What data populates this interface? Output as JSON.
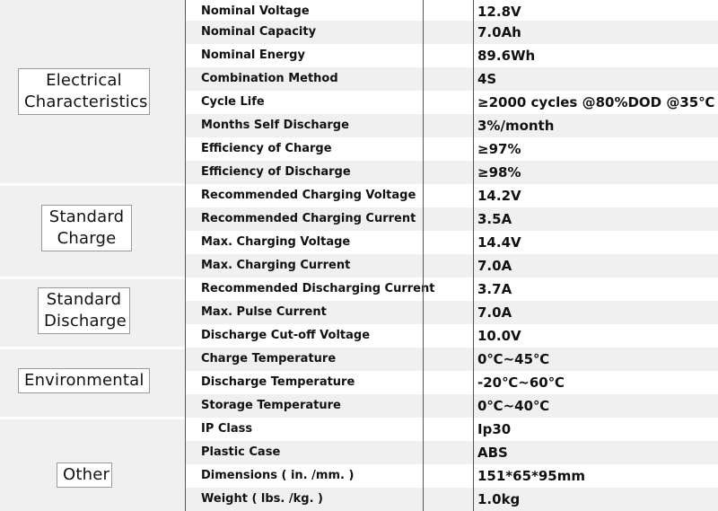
{
  "sections": [
    {
      "category": "Electrical Characteristics",
      "category_lines": [
        "Electrical",
        "Characteristics"
      ],
      "rows": [
        {
          "param": "Nominal Voltage",
          "value": "12.8V"
        },
        {
          "param": "Nominal Capacity",
          "value": "7.0Ah"
        },
        {
          "param": "Nominal  Energy",
          "value": "89.6Wh"
        },
        {
          "param": "Combination Method",
          "value": "4S"
        },
        {
          "param": "Cycle  Life",
          "value": "≥2000 cycles @80%DOD @35℃"
        },
        {
          "param": "Months Self Discharge",
          "value": "3%/month"
        },
        {
          "param": "Efficiency of Charge",
          "value": "≥97%"
        },
        {
          "param": "Efficiency of Discharge",
          "value": "≥98%"
        }
      ]
    },
    {
      "category": "Standard Charge",
      "category_lines": [
        "Standard",
        "Charge"
      ],
      "rows": [
        {
          "param": "Recommended Charging Voltage",
          "value": "14.2V"
        },
        {
          "param": "Recommended Charging Current",
          "value": "3.5A"
        },
        {
          "param": "Max.  Charging Voltage",
          "value": "14.4V"
        },
        {
          "param": "Max.  Charging Current",
          "value": "7.0A"
        }
      ]
    },
    {
      "category": "Standard Discharge",
      "category_lines": [
        "Standard",
        "Discharge"
      ],
      "rows": [
        {
          "param": "Recommended Discharging Current",
          "value": "3.7A"
        },
        {
          "param": "Max.  Pulse Current",
          "value": "7.0A"
        },
        {
          "param": "Discharge Cut-off Voltage",
          "value": "10.0V"
        }
      ]
    },
    {
      "category": "Environmental",
      "category_lines": [
        "Environmental"
      ],
      "rows": [
        {
          "param": "Charge  Temperature",
          "value": "0℃~45℃"
        },
        {
          "param": "Discharge  Temperature",
          "value": "-20℃~60℃"
        },
        {
          "param": "Storage  Temperature",
          "value": "0℃~40℃"
        }
      ]
    },
    {
      "category": "Other",
      "category_lines": [
        "Other"
      ],
      "rows": [
        {
          "param": "IP Class",
          "value": "Ip30"
        },
        {
          "param": "Plastic  Case",
          "value": "ABS"
        },
        {
          "param": "Dimensions ( in. /mm. )",
          "value": "151*65*95mm"
        },
        {
          "param": "Weight ( lbs. /kg. )",
          "value": "1.0kg"
        }
      ]
    }
  ]
}
